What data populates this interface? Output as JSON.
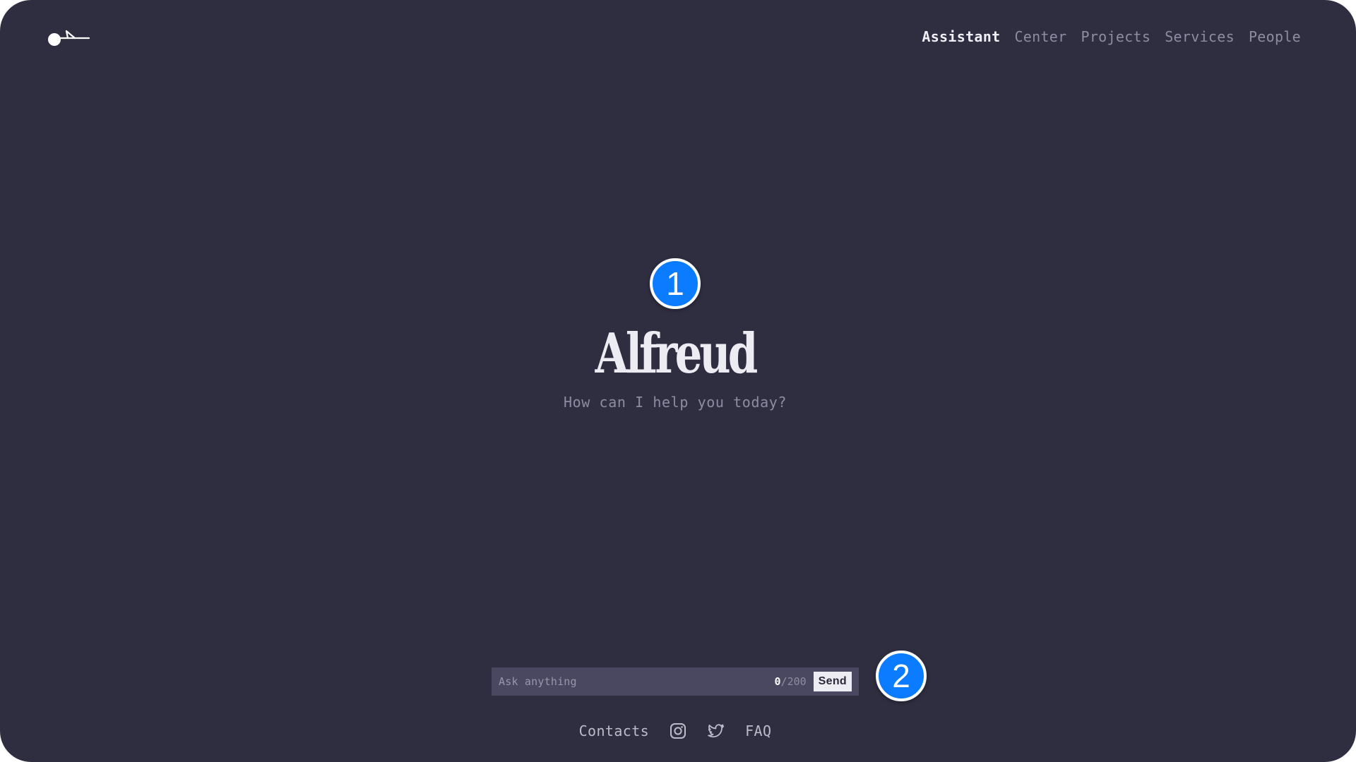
{
  "app": {
    "brand_name": "Alfreud",
    "logo_icon": "logo-icon"
  },
  "nav": {
    "items": [
      {
        "label": "Assistant",
        "active": true
      },
      {
        "label": "Center",
        "active": false
      },
      {
        "label": "Projects",
        "active": false
      },
      {
        "label": "Services",
        "active": false
      },
      {
        "label": "People",
        "active": false
      }
    ]
  },
  "hero": {
    "title": "Alfreud",
    "subtitle": "How can I help you today?"
  },
  "annotations": {
    "badge_1": "1",
    "badge_2": "2"
  },
  "chat": {
    "placeholder": "Ask anything",
    "value": "",
    "count": "0",
    "max": "/200",
    "send_label": "Send"
  },
  "footer": {
    "contacts_label": "Contacts",
    "instagram_icon": "instagram-icon",
    "twitter_icon": "twitter-icon",
    "faq_label": "FAQ"
  },
  "colors": {
    "background": "#2f2e41",
    "nav_inactive": "#8e8ca1",
    "nav_active": "#f1eff6",
    "input_bg": "#4a4860",
    "badge": "#0b7cff"
  }
}
